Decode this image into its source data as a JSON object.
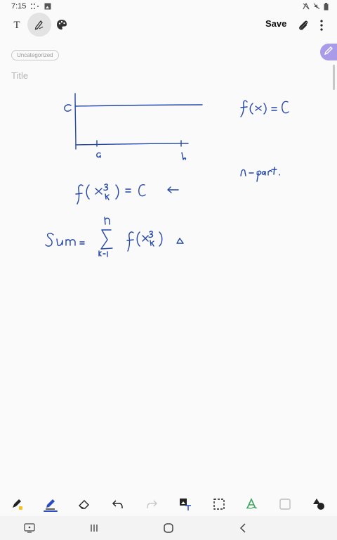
{
  "status_bar": {
    "time": "7:15",
    "icons": [
      "dots-icon",
      "gallery-icon",
      "vibrate-icon",
      "mute-icon",
      "battery-icon"
    ]
  },
  "toolbar": {
    "save_label": "Save",
    "tools": [
      "text-mode-icon",
      "pen-mode-icon",
      "palette-icon"
    ],
    "text_tool_label": "T",
    "actions": [
      "attach-icon",
      "more-icon"
    ]
  },
  "note": {
    "category": "Uncategorized",
    "title_placeholder": "Title"
  },
  "handwriting": {
    "ink_color": "#2346a8",
    "lines": [
      "c",
      "a",
      "b",
      "f(x) = C",
      "n - part.",
      "f ( x*ₖ ) = C",
      "Sum = Σ f(x*ₖ) Δ",
      "n",
      "k=1"
    ]
  },
  "bottom_toolbar": {
    "tools": [
      "highlighter-icon",
      "pen-icon",
      "eraser-icon",
      "undo-icon",
      "redo-icon",
      "image-text-icon",
      "selection-icon",
      "handwriting-icon",
      "shape-icon",
      "shapes-icon"
    ],
    "selected": "pen-icon",
    "accent_color": "#2c4cc4"
  },
  "nav_bar": {
    "buttons": [
      "keyboard-icon",
      "recents-icon",
      "home-icon",
      "back-icon"
    ]
  }
}
